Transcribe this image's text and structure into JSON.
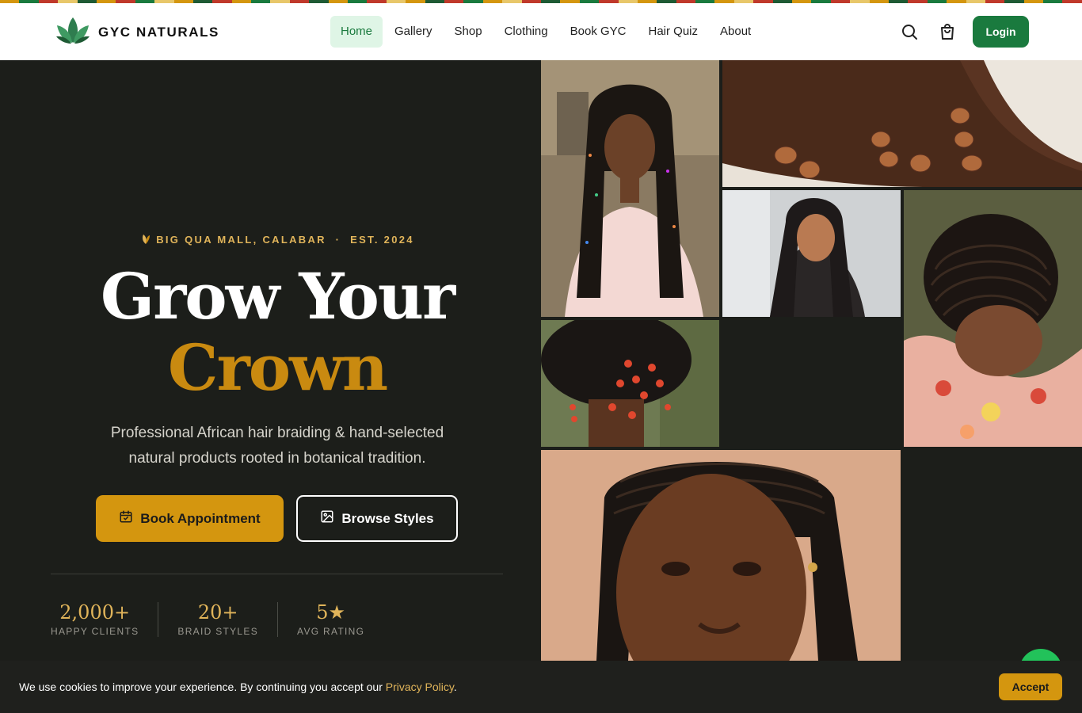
{
  "brand": {
    "name": "GYC NATURALS",
    "primary_green": "#1a7a3e",
    "gold": "#d4960f",
    "dark_bg": "#1c1e1a"
  },
  "nav": {
    "items": [
      "Home",
      "Gallery",
      "Shop",
      "Clothing",
      "Book GYC",
      "Hair Quiz",
      "About"
    ],
    "active": "Home"
  },
  "header": {
    "search_icon": "search-icon",
    "cart_icon": "shopping-bag-icon",
    "login_label": "Login"
  },
  "hero": {
    "tagline": "BIG QUA MALL, CALABAR  ·  EST. 2024",
    "title_line1": "Grow Your",
    "title_line2": "Crown",
    "subtitle": "Professional African hair braiding & hand-selected natural products rooted in botanical tradition.",
    "book_label": "Book Appointment",
    "browse_label": "Browse Styles",
    "stats": [
      {
        "value": "2,000+",
        "label": "HAPPY CLIENTS"
      },
      {
        "value": "20+",
        "label": "BRAID STYLES"
      },
      {
        "value": "5★",
        "label": "AVG RATING"
      }
    ]
  },
  "gallery": {
    "images": [
      "box-braids-beads-portrait",
      "braid-beads-closeup",
      "braids-selfie",
      "cornrows-top-view",
      "red-coral-bead-updo",
      "cornrows-face-portrait"
    ]
  },
  "cookie": {
    "text": "We use cookies to improve your experience. By continuing you accept our ",
    "link": "Privacy Policy",
    "after": ".",
    "accept_label": "Accept"
  }
}
